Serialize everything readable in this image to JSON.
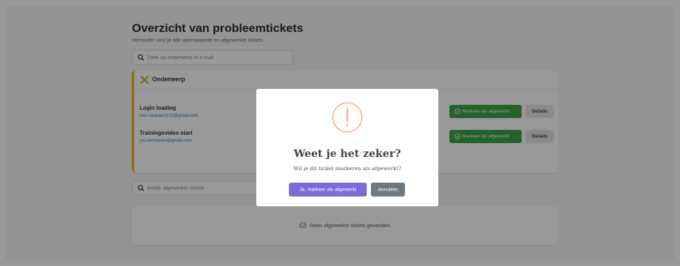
{
  "header": {
    "title": "Overzicht van probleemtickets",
    "subtitle": "Hieronder vind je alle openstaande en afgewerkte tickets."
  },
  "search": {
    "placeholder": "Zoek op onderwerp of e-mail"
  },
  "open_panel": {
    "heading": "Onderwerp",
    "tickets": [
      {
        "subject": "Login loading",
        "email": "bas.vanbaert123@gmail.com",
        "done_label": "Markeer als afgewerkt",
        "details_label": "Details"
      },
      {
        "subject": "Trainingsvideo start",
        "email": "jos.vermeiren@gmail.com",
        "done_label": "Markeer als afgewerkt",
        "details_label": "Details"
      }
    ]
  },
  "done_search": {
    "placeholder": "Bekijk afgewerkte tickets"
  },
  "done_panel": {
    "empty_text": "Geen afgewerkte tickets gevonden."
  },
  "modal": {
    "title": "Weet je het zeker?",
    "text": "Wil je dit ticket markeren als afgewerkt?",
    "confirm_label": "Ja, markeer als afgewerkt",
    "cancel_label": "Annuleer",
    "colors": {
      "confirm": "#7b6ad8",
      "cancel": "#6e7881",
      "warning": "#f5b184"
    }
  },
  "colors": {
    "accent_border": "#f2b705",
    "success": "#3aa641",
    "link": "#3a6fd8"
  },
  "icons": {
    "search": "search-icon",
    "tools": "tools-icon",
    "check": "check-circle-icon",
    "inbox": "inbox-icon",
    "warning": "exclamation-icon"
  }
}
